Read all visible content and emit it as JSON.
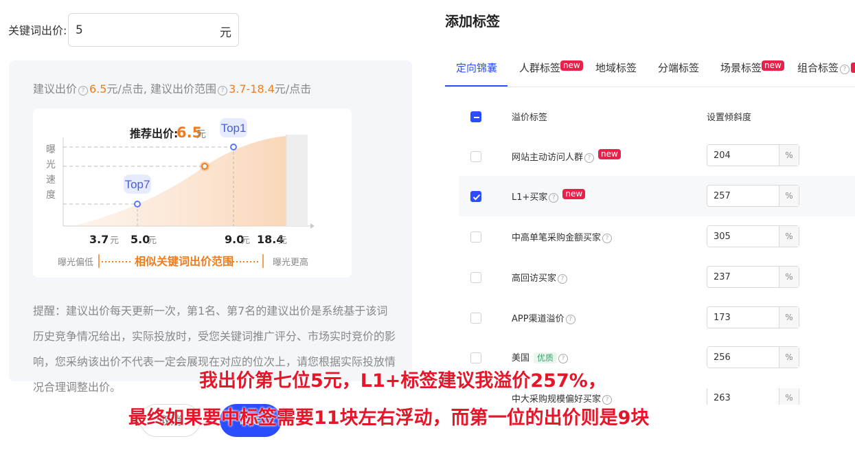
{
  "left": {
    "keyword_label": "关键词出价:",
    "keyword_value": "5",
    "keyword_unit": "元",
    "suggestion": {
      "prefix": "建议出价",
      "price": "6.5",
      "price_unit": "元/点击,",
      "range_label": "建议出价范围",
      "range": "3.7-18.4",
      "range_unit": "元/点击"
    },
    "chart": {
      "y_label": [
        "曝",
        "光",
        "速",
        "度"
      ],
      "recommend_label": "推荐出价:",
      "recommend_value": "6.5",
      "recommend_unit": "元",
      "top1": "Top1",
      "top7": "Top7",
      "ticks": [
        {
          "num": "3.7",
          "unit": "元"
        },
        {
          "num": "5.0",
          "unit": "元"
        },
        {
          "num": "9.0",
          "unit": "元"
        },
        {
          "num": "18.4",
          "unit": "元"
        }
      ],
      "low_label": "曝光偏低",
      "range_text": "相似关键词出价范围",
      "high_label": "曝光更高"
    },
    "tip": "提醒：建议出价每天更新一次，第1名、第7名的建议出价是系统基于该词历史竞争情况给出，实际投放时，受您关键词推广评分、市场实时竞价的影响，您采纳该出价不代表一定会展现在对应的位次上，请您根据实际投放情况合理调整出价。",
    "cancel": "取消",
    "confirm": "确定"
  },
  "right": {
    "title": "添加标签",
    "tabs": [
      {
        "label": "定向锦囊",
        "new": ""
      },
      {
        "label": "人群标签",
        "new": "new"
      },
      {
        "label": "地域标签",
        "new": ""
      },
      {
        "label": "分端标签",
        "new": ""
      },
      {
        "label": "场景标签",
        "new": "new"
      },
      {
        "label": "组合标签",
        "new": ""
      }
    ],
    "col_tag": "溢价标签",
    "col_slope": "设置倾斜度",
    "pct_unit": "%",
    "new_badge": "new",
    "rows": [
      {
        "label": "网站主动访问人群",
        "value": "204",
        "checked": false
      },
      {
        "label": "L1+买家",
        "value": "257",
        "checked": true
      },
      {
        "label": "中高单笔采购金额买家",
        "value": "305",
        "checked": false
      },
      {
        "label": "高回访买家",
        "value": "237",
        "checked": false
      },
      {
        "label": "APP渠道溢价",
        "value": "173",
        "checked": false
      },
      {
        "label": "美国",
        "badge": "优质",
        "value": "256",
        "checked": false
      },
      {
        "label": "中大采购规模偏好买家",
        "value": "263",
        "checked": false
      }
    ]
  },
  "annotation": {
    "line1": "我出价第七位5元，L1+标签建议我溢价257%，",
    "line2": "最终如果要中标签需要11块左右浮动，而第一位的出价则是9块"
  },
  "colors": {
    "accent": "#2b4dff",
    "orange": "#f07c1c",
    "new_badge": "#e8204a",
    "annotation": "#e5162a"
  }
}
